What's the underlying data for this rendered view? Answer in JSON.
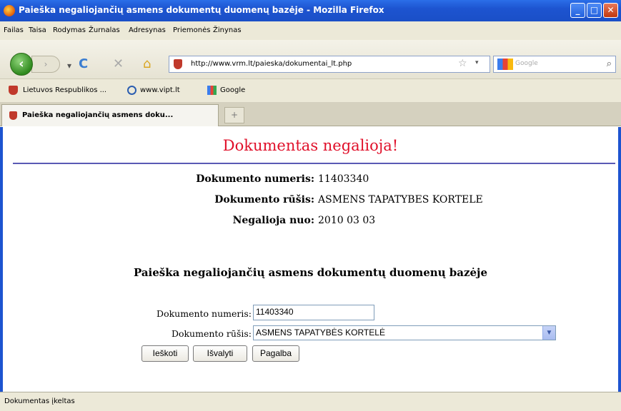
{
  "window": {
    "title": "Paieška negaliojančių asmens dokumentų duomenų bazėje - Mozilla Firefox",
    "minimize": "_",
    "maximize": "□",
    "close": "✕"
  },
  "menu": [
    "Failas",
    "Taisa",
    "Rodymas",
    "Žurnalas",
    "Adresynas",
    "Priemonės",
    "Žinynas"
  ],
  "nav": {
    "url": "http://www.vrm.lt/paieska/dokumentai_lt.php",
    "search_placeholder": "Google",
    "back": "‹",
    "forward": "›",
    "reload": "C",
    "stop": "✕",
    "home": "⌂",
    "star": "☆",
    "dropdown": "▾",
    "magnifier": "⌕"
  },
  "bookmarks": [
    "Lietuvos Respublikos ...",
    "www.vipt.lt",
    "Google"
  ],
  "tab": {
    "label": "Paieška negaliojančių asmens doku...",
    "new_tab": "+"
  },
  "page": {
    "heading": "Dokumentas negalioja!",
    "info": [
      {
        "label": "Dokumento numeris:",
        "value": "11403340"
      },
      {
        "label": "Dokumento rūšis:",
        "value": "ASMENS TAPATYBES KORTELE"
      },
      {
        "label": "Negalioja nuo:",
        "value": "2010 03 03"
      }
    ],
    "section_title": "Paieška negaliojančių asmens dokumentų duomenų bazėje",
    "form": {
      "number_label": "Dokumento numeris:",
      "number_value": "11403340",
      "type_label": "Dokumento rūšis:",
      "type_value": "ASMENS TAPATYBĖS KORTELĖ",
      "buttons": [
        "Ieškoti",
        "Išvalyti",
        "Pagalba"
      ]
    }
  },
  "status": "Dokumentas įkeltas"
}
